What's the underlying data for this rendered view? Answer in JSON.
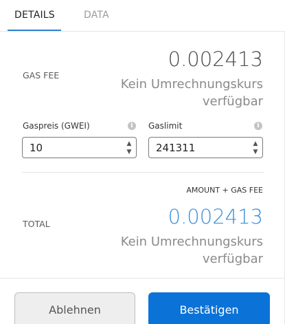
{
  "tabs": [
    {
      "label": "DETAILS",
      "active": true
    },
    {
      "label": "DATA",
      "active": false
    }
  ],
  "gas_fee": {
    "label": "GAS FEE",
    "value": "0.002413",
    "fiat": "Kein Umrechnungskurs verfügbar"
  },
  "gas_price": {
    "label": "Gaspreis (GWEI)",
    "value": "10",
    "info_icon": "info-icon"
  },
  "gas_limit": {
    "label": "Gaslimit",
    "value": "241311",
    "info_icon": "info-icon"
  },
  "total": {
    "heading": "AMOUNT + GAS FEE",
    "label": "TOTAL",
    "value": "0.002413",
    "fiat": "Kein Umrechnungskurs verfügbar"
  },
  "buttons": {
    "reject": "Ablehnen",
    "confirm": "Bestätigen"
  },
  "colors": {
    "accent": "#0b73d8",
    "total_value": "#3b8fd8"
  }
}
